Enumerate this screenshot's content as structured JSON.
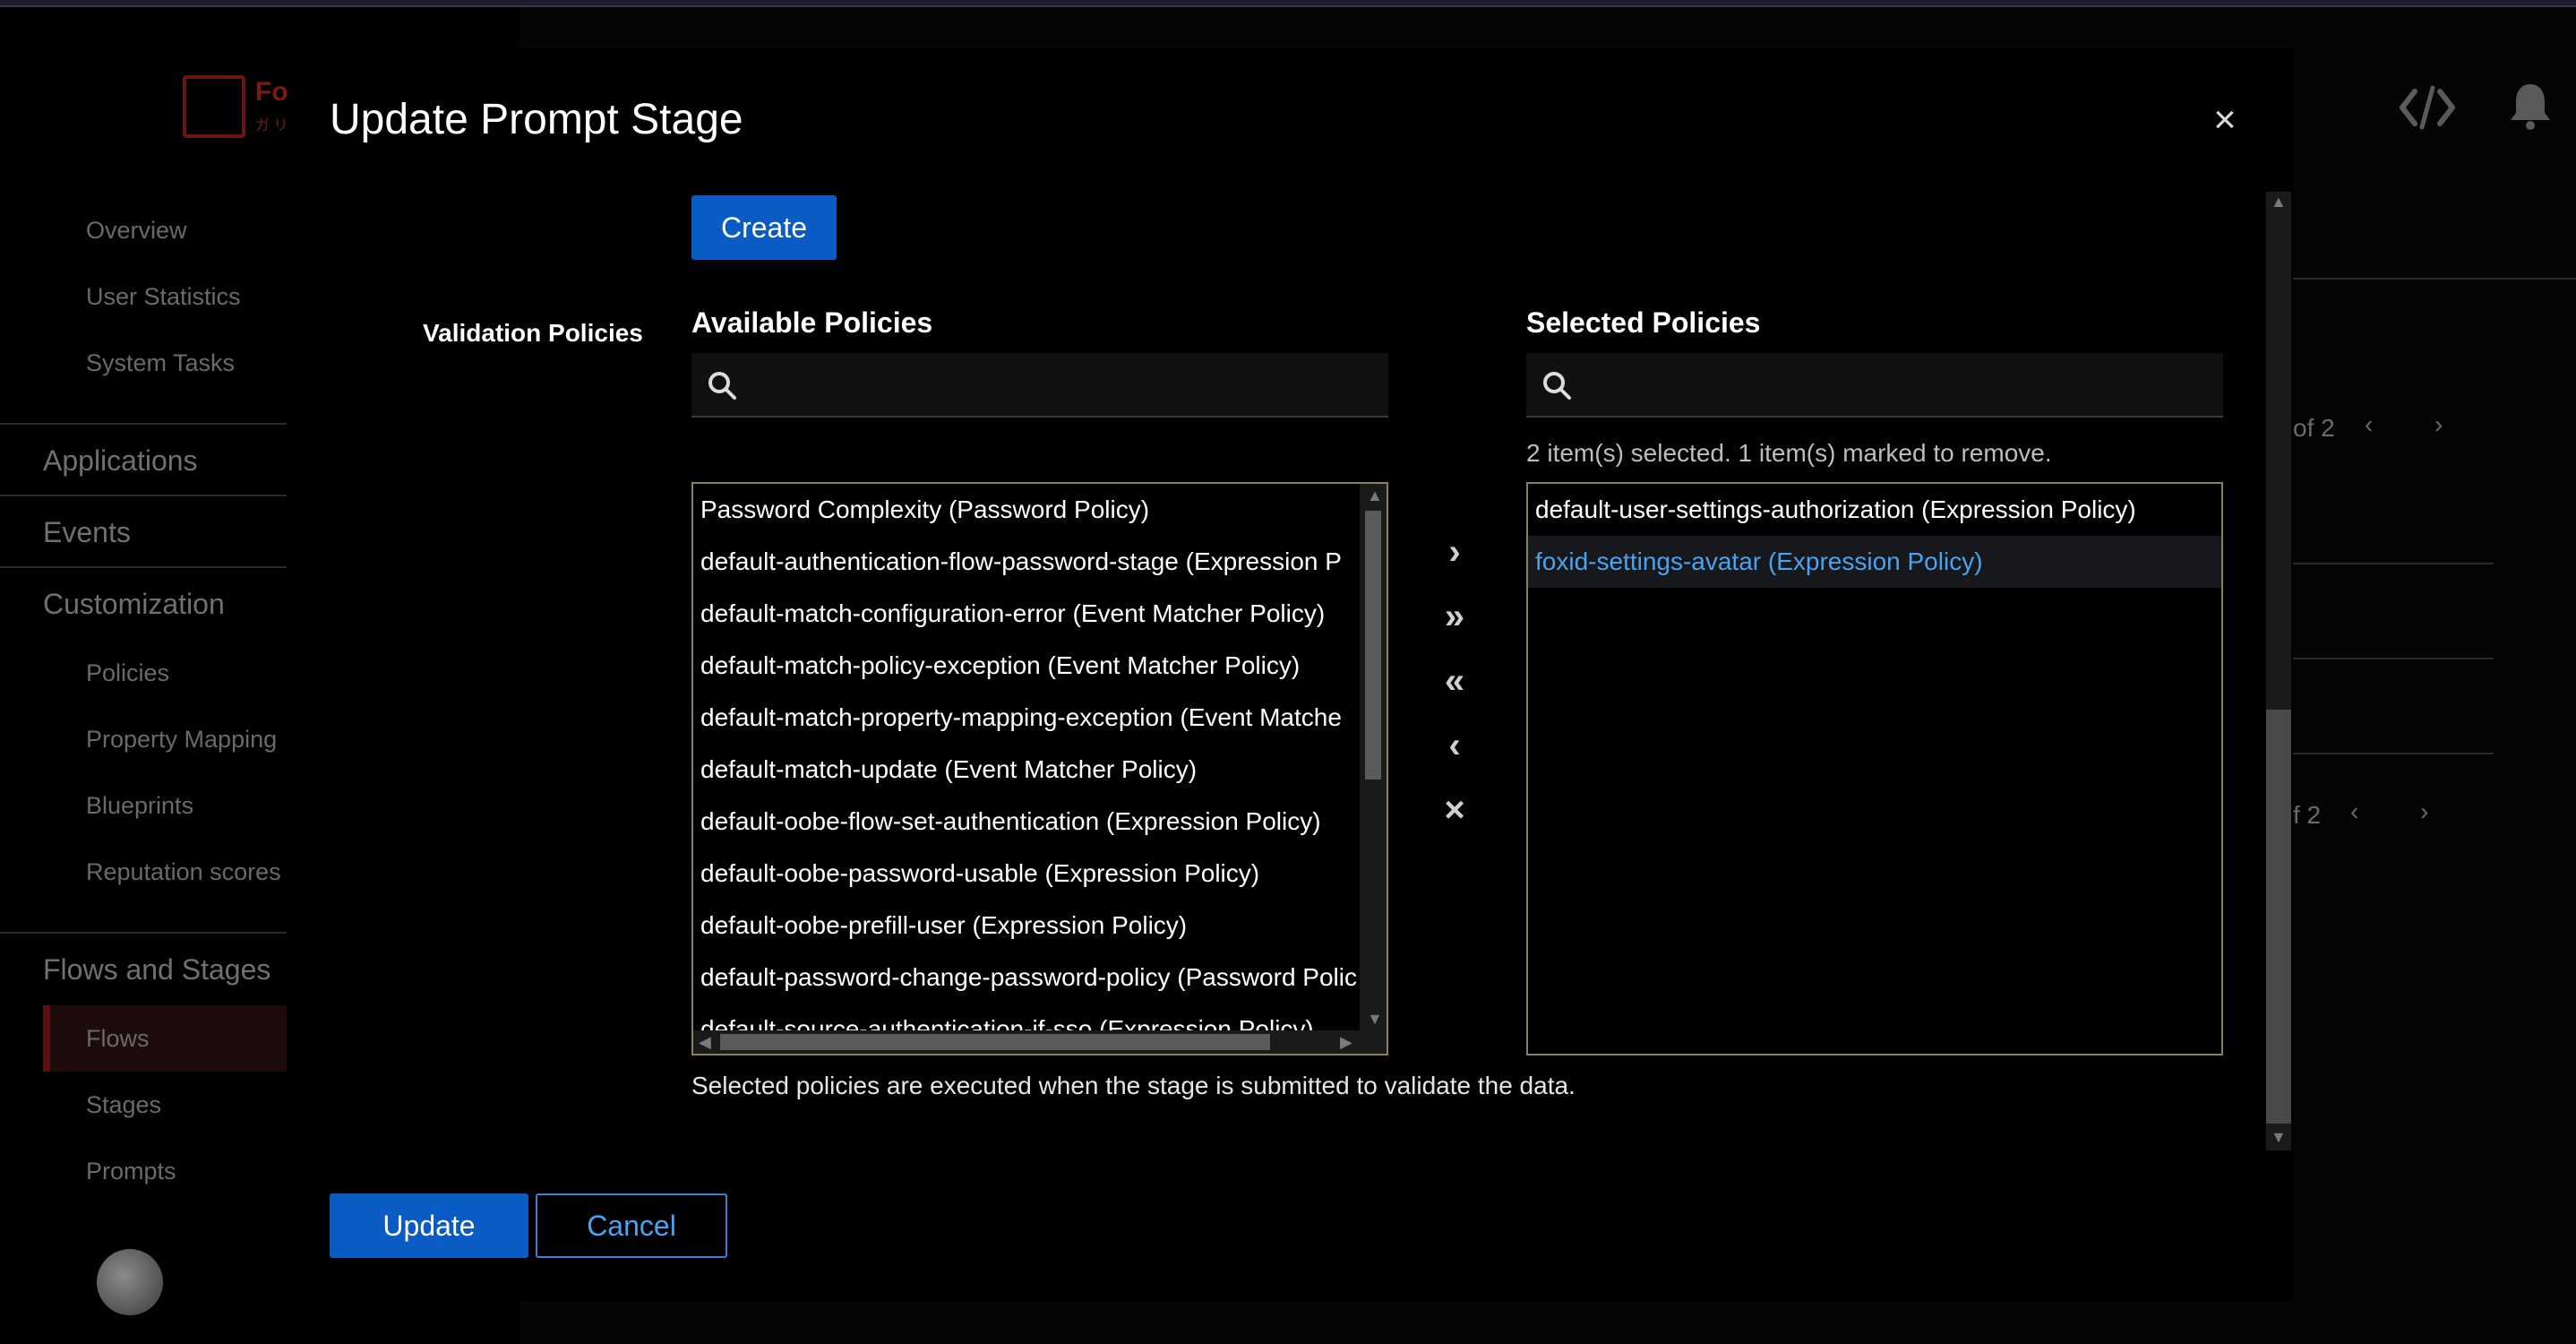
{
  "sidebar": {
    "logo_text": "Fo",
    "logo_sub": "ガ リ",
    "items_top": [
      "Overview",
      "User Statistics",
      "System Tasks"
    ],
    "sections": {
      "applications": "Applications",
      "events": "Events",
      "customization": "Customization",
      "flows_and_stages": "Flows and Stages"
    },
    "customization_items": [
      "Policies",
      "Property Mapping",
      "Blueprints",
      "Reputation scores"
    ],
    "flows_items": [
      "Flows",
      "Stages",
      "Prompts"
    ]
  },
  "background": {
    "pagination_top": "of 2",
    "pagination_bottom": "f 2"
  },
  "modal": {
    "title": "Update Prompt Stage",
    "create_label": "Create",
    "field_label": "Validation Policies",
    "available_title": "Available Policies",
    "selected_title": "Selected Policies",
    "status": "2 item(s) selected. 1 item(s) marked to remove.",
    "available_items": [
      "Password Complexity (Password Policy)",
      "default-authentication-flow-password-stage (Expression P",
      "default-match-configuration-error (Event Matcher Policy)",
      "default-match-policy-exception (Event Matcher Policy)",
      "default-match-property-mapping-exception (Event Matche",
      "default-match-update (Event Matcher Policy)",
      "default-oobe-flow-set-authentication (Expression Policy)",
      "default-oobe-password-usable (Expression Policy)",
      "default-oobe-prefill-user (Expression Policy)",
      "default-password-change-password-policy (Password Polic",
      "default-source-authentication-if-sso (Expression Policy)"
    ],
    "selected_items": [
      "default-user-settings-authorization (Expression Policy)",
      "foxid-settings-avatar (Expression Policy)"
    ],
    "helper_text": "Selected policies are executed when the stage is submitted to validate the data.",
    "update_label": "Update",
    "cancel_label": "Cancel"
  },
  "colors": {
    "primary": "#0a5bc4",
    "link": "#4aa3f2",
    "list_border": "#8a7e63"
  }
}
